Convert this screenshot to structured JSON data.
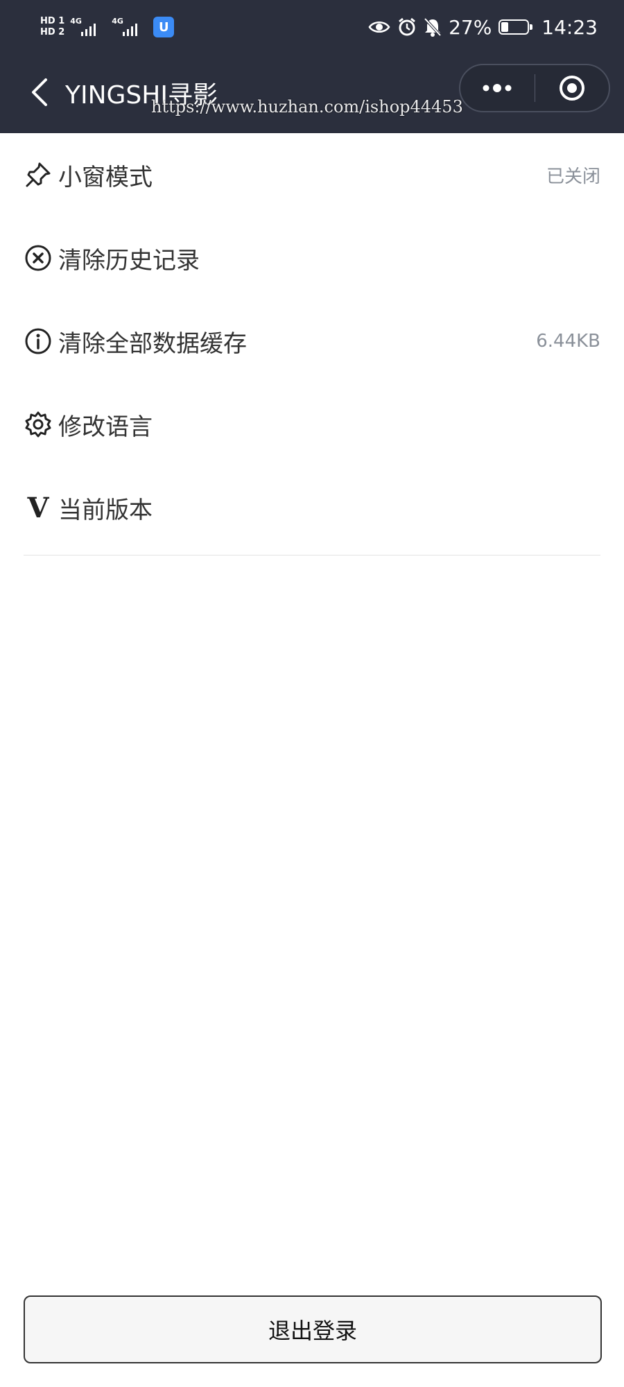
{
  "statusbar": {
    "sim1": "HD 1",
    "sim2": "HD 2",
    "network1": "4G",
    "network2": "4G",
    "app_badge": "U",
    "battery_text": "27%",
    "battery_level": 0.27,
    "time": "14:23",
    "icons": [
      "eye-icon",
      "alarm-icon",
      "bell-off-icon"
    ]
  },
  "navbar": {
    "title": "YINGSHI寻影",
    "watermark": "https://www.huzhan.com/ishop44453"
  },
  "settings": {
    "items": [
      {
        "icon": "pin-icon",
        "label": "小窗模式",
        "value": "已关闭"
      },
      {
        "icon": "close-circle-icon",
        "label": "清除历史记录",
        "value": ""
      },
      {
        "icon": "info-icon",
        "label": "清除全部数据缓存",
        "value": "6.44KB"
      },
      {
        "icon": "gear-icon",
        "label": "修改语言",
        "value": ""
      },
      {
        "icon": "v-icon",
        "label": "当前版本",
        "value": ""
      }
    ]
  },
  "logout_label": "退出登录",
  "colors": {
    "header_bg": "#2b2f3d",
    "value_text": "#8a9099"
  }
}
